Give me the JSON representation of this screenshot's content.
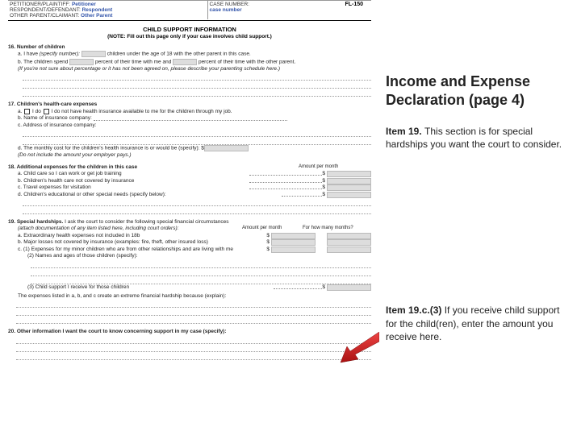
{
  "corner_code": "FL-150",
  "header": {
    "petitioner_label": "PETITIONER/PLAINTIFF:",
    "petitioner_value": "Petitioner",
    "respondent_label": "RESPONDENT/DEFENDANT:",
    "respondent_value": "Respondent",
    "other_label": "OTHER PARENT/CLAIMANT:",
    "other_value": "Other Parent",
    "case_label": "CASE NUMBER:",
    "case_value": "case number"
  },
  "section": {
    "title": "CHILD SUPPORT INFORMATION",
    "note": "(NOTE: Fill out this page only if your case involves child support.)"
  },
  "items": {
    "i16": {
      "heading": "16.  Number of children",
      "a_pre": "a.  I have",
      "a_spec": "(specify number):",
      "a_post": "children under the age of 18 with the other parent in this case.",
      "b_pre": "b.  The children spend",
      "b_mid": "percent of their time with me and",
      "b_post": "percent of their time with the other parent.",
      "b_note": "(If you're not sure about percentage or it has not been agreed on, please describe your parenting schedule here.)"
    },
    "i17": {
      "heading": "17.  Children's health-care expenses",
      "a_pre": "a.",
      "a_do": "I do",
      "a_dont": "I do not",
      "a_post": "have health insurance available to me for the children through my job.",
      "b": "b.  Name of insurance company:",
      "c": "c.  Address of insurance company:",
      "d_pre": "d.  The monthly cost for the children's health insurance is or would be (specify):  $",
      "d_note": "(Do not include the amount your employer pays.)"
    },
    "i18": {
      "heading": "18.  Additional expenses for the children in this case",
      "col_amount": "Amount per month",
      "a": "a.  Child care so I can work or get job training",
      "b": "b.  Children's health care not covered by insurance",
      "c": "c.  Travel expenses for visitation",
      "d": "d.  Children's educational or other special needs (specify below):"
    },
    "i19": {
      "heading_pre": "19.  Special hardships.",
      "heading_post": "I ask the court to consider the following special financial circumstances",
      "note": "(attach documentation of any item listed here, including court orders):",
      "col_amount": "Amount per month",
      "col_months": "For how many months?",
      "a": "a.  Extraordinary health expenses not included in 18b",
      "b": "b.  Major losses not covered by insurance (examples: fire, theft, other insured loss)",
      "c1": "c.  (1) Expenses for my minor children who are from other relationships and are living with me",
      "c2": "(2) Names and ages of those children (specify):",
      "c3": "(3) Child support I receive for those children",
      "footer": "The expenses listed in a, b, and c create an extreme financial hardship because (explain):"
    },
    "i20": {
      "heading": "20.  Other information I want the court to know concerning support in my case (specify):"
    }
  },
  "right": {
    "title": "Income and Expense Declaration (page 4)",
    "p1_bold": "Item 19.",
    "p1": "This section is for special hardships you want the court to consider.",
    "p2_bold": "Item 19.c.(3)",
    "p2": "If you receive child support for the child(ren), enter the amount you receive here."
  }
}
